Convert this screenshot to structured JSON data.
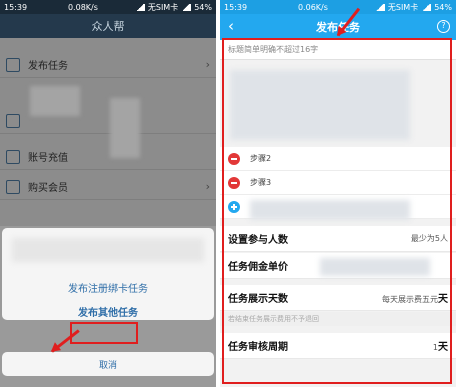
{
  "left_phone": {
    "status": {
      "time": "15:39",
      "speed": "0.08K/s",
      "carrier": "无SIM卡",
      "battery": "54%"
    },
    "title": "众人帮",
    "menu": [
      {
        "label": "发布任务",
        "icon": "edit-icon"
      },
      {
        "label": "",
        "icon": "chart-icon"
      },
      {
        "label": "账号充值",
        "icon": "wallet-icon"
      },
      {
        "label": "购买会员",
        "icon": "cart-icon"
      }
    ],
    "action_sheet": {
      "option1": "发布注册绑卡任务",
      "option2": "发布其他任务",
      "cancel": "取消"
    }
  },
  "right_phone": {
    "status": {
      "time": "15:39",
      "speed": "0.06K/s",
      "carrier": "无SIM卡",
      "battery": "54%"
    },
    "title": "发布任务",
    "title_placeholder": "标题简单明确不超过16字",
    "steps": [
      "步骤2",
      "步骤3"
    ],
    "fields": {
      "participants": {
        "label": "设置参与人数",
        "value": "最少为5人"
      },
      "unit_price": {
        "label": "任务佣金单价",
        "value": ""
      },
      "display_days": {
        "label": "任务展示天数",
        "value_prefix": "每天展示费五元",
        "value_unit": "天"
      },
      "note": "若结束任务展示费用不予退回",
      "review_period": {
        "label": "任务审核周期",
        "value_num": "1",
        "value_unit": "天"
      }
    },
    "colors": {
      "nav": "#23a8ef",
      "highlight": "#e01e1e"
    }
  }
}
